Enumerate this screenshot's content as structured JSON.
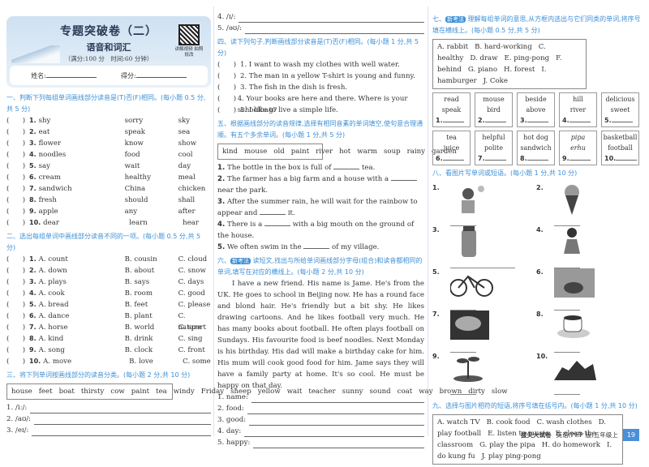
{
  "header": {
    "title": "专题突破卷（二）",
    "subtitle": "语音和词汇",
    "meta": "（满分:100 分　时间:60 分钟）",
    "qr_label": "讲解视频 拍照批改",
    "name_label": "姓名:",
    "score_label": "得分:"
  },
  "s1": {
    "title": "一、判断下列每组单词画线部分读音是(T)否(F)相同。(每小题 0.5 分,共 5 分)",
    "rows": [
      [
        "1.",
        "shy",
        "sorry",
        "sky"
      ],
      [
        "2.",
        "eat",
        "speak",
        "sea"
      ],
      [
        "3.",
        "flower",
        "know",
        "show"
      ],
      [
        "4.",
        "noodles",
        "food",
        "cool"
      ],
      [
        "5.",
        "say",
        "wait",
        "day"
      ],
      [
        "6.",
        "cream",
        "healthy",
        "meal"
      ],
      [
        "7.",
        "sandwich",
        "China",
        "chicken"
      ],
      [
        "8.",
        "fresh",
        "should",
        "shall"
      ],
      [
        "9.",
        "apple",
        "any",
        "after"
      ],
      [
        "10.",
        "dear",
        "learn",
        "hear"
      ]
    ]
  },
  "s2": {
    "title": "二、选出每组单词中画线部分读音不同的一项。(每小题 0.5 分,共 5 分)",
    "rows": [
      [
        "1.",
        "A. count",
        "B. cousin",
        "C. cloud"
      ],
      [
        "2.",
        "A. down",
        "B. about",
        "C. snow"
      ],
      [
        "3.",
        "A. plays",
        "B. says",
        "C. days"
      ],
      [
        "4.",
        "A. cook",
        "B. room",
        "C. good"
      ],
      [
        "5.",
        "A. bread",
        "B. feet",
        "C. please"
      ],
      [
        "6.",
        "A. dance",
        "B. plant",
        "C. nature"
      ],
      [
        "7.",
        "A. horse",
        "B. world",
        "C. sport"
      ],
      [
        "8.",
        "A. kind",
        "B. drink",
        "C. sing"
      ],
      [
        "9.",
        "A. song",
        "B. clock",
        "C. front"
      ],
      [
        "10.",
        "A. move",
        "B. love",
        "C. some"
      ]
    ]
  },
  "s3": {
    "title": "三、将下列单词按画线部分的读音分类。(每小题 2 分,共 10 分)",
    "words": [
      "house",
      "feet",
      "boat",
      "thirsty",
      "cow",
      "paint",
      "tea",
      "windy",
      "Friday",
      "sheep",
      "yellow",
      "wait",
      "teacher",
      "sunny",
      "sound",
      "coat",
      "way",
      "brown",
      "dirty",
      "slow"
    ],
    "answers": [
      "1. /iː/:",
      "2. /aʊ/:",
      "3. /eɪ/:",
      "4. /ɪ/:",
      "5. /əʊ/:"
    ]
  },
  "s4": {
    "title": "四、读下列句子,判断画线部分读音是(T)否(F)相同。(每小题 1 分,共 5 分)",
    "rows": [
      "1. I want to wash my clothes with well water.",
      "2. The man in a yellow T-shirt is young and funny.",
      "3. The fish in the dish is fresh.",
      "4. Your books are here and there. Where is your schoolbag?",
      "5. I like to live a simple life."
    ]
  },
  "s5": {
    "title": "五、根据画线部分的读音规律,选择有相同音素的单词填空,使句意合理通顺。有五个多余单词。(每小题 1 分,共 5 分)",
    "words": [
      "kind",
      "mouse",
      "old",
      "paint",
      "river",
      "hot",
      "warm",
      "soup",
      "rainy",
      "garden"
    ],
    "q": [
      {
        "n": "1.",
        "a": "The bottle in the box is full of",
        "b": "tea."
      },
      {
        "n": "2.",
        "a": "The farmer has a big farm and a house with a",
        "b": "near the park."
      },
      {
        "n": "3.",
        "a": "After the summer rain, he will wait for the rainbow to appear and",
        "b": "it."
      },
      {
        "n": "4.",
        "a": "There is a",
        "b": "with a big mouth on the ground of the house."
      },
      {
        "n": "5.",
        "a": "We often swim in the",
        "b": "of my village."
      }
    ]
  },
  "s6": {
    "badge": "新考法",
    "title": "读短文,找出与所给单词画线部分字母(组合)和读音都相同的单词,填写在对应的横线上。(每小题 2 分,共 10 分)",
    "prefix": "六、",
    "passage": "I have a new friend. His name is Jame. He's from the UK. He goes to school in Beijing now. He has a round face and blond hair. He's friendly but a bit shy. He likes drawing cartoons. And he likes football very much. He has many books about football. He often plays football on Sundays. His favourite food is beef noodles. Next Monday is his birthday. His dad will make a birthday cake for him. His mum will cook good food for him. Jame says they will have a family party at home. It's so cool. He must be happy on that day.",
    "answers": [
      "1. name:",
      "2. food:",
      "3. good:",
      "4. day:",
      "5. happy:"
    ]
  },
  "s7": {
    "prefix": "七、",
    "badge": "新考法",
    "title": "理解每组单词的意思,从方框内选出与它们同类的单词,将序号填在横线上。(每小题 0.5 分,共 5 分)",
    "options": [
      "A. rabbit",
      "B. hard-working",
      "C. healthy",
      "D. draw",
      "E. ping-pong",
      "F. behind",
      "G. piano",
      "H. forest",
      "I. hamburger",
      "J. Coke"
    ],
    "groups": [
      [
        "read",
        "speak",
        "1."
      ],
      [
        "mouse",
        "bird",
        "2."
      ],
      [
        "beside",
        "above",
        "3."
      ],
      [
        "hill",
        "river",
        "4."
      ],
      [
        "delicious",
        "sweet",
        "5."
      ],
      [
        "tea",
        "juice",
        "6."
      ],
      [
        "helpful",
        "polite",
        "7."
      ],
      [
        "hot dog",
        "sandwich",
        "8."
      ],
      [
        "pipa",
        "erhu",
        "9."
      ],
      [
        "basketball",
        "football",
        "10."
      ]
    ]
  },
  "s8": {
    "title": "八、看图片写单词或短语。(每小题 1 分,共 10 分)",
    "nums": [
      "1.",
      "2.",
      "3.",
      "4.",
      "5.",
      "6.",
      "7.",
      "8.",
      "9.",
      "10."
    ]
  },
  "s9": {
    "title": "九、选择与图片相符的短语,将序号填在括号内。(每小题 1 分,共 10 分)",
    "options": [
      "A. watch TV",
      "B. cook food",
      "C. wash clothes",
      "D. play football",
      "E. listen to music",
      "F. clean the classroom",
      "G. play the pipa",
      "H. do homework",
      "I. do kung fu",
      "J. play ping-pong"
    ]
  },
  "footer": {
    "brand": "拔尖大试卷",
    "subject": "英语(PEP 版)五年级上",
    "page": "19"
  }
}
